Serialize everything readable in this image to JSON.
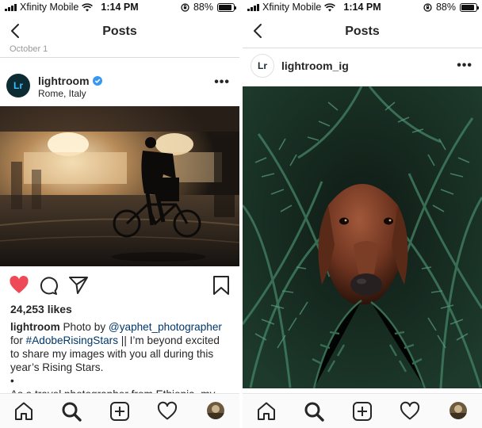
{
  "status_bar": {
    "carrier": "Xfinity Mobile",
    "time": "1:14 PM",
    "battery": "88%",
    "battery_level": 0.88
  },
  "colors": {
    "like_red": "#ed4956",
    "link_blue": "#00376b",
    "verified_blue": "#3897f0",
    "divider": "#dbdbdb"
  },
  "left_screen": {
    "nav_title": "Posts",
    "date_fragment": "October 1",
    "post": {
      "username": "lightroom",
      "verified": true,
      "location": "Rome, Italy",
      "more_icon": "more-dots-icon",
      "liked": true,
      "likes": "24,253 likes",
      "caption": {
        "username": "lightroom",
        "text1": " Photo by ",
        "mention": "@yaphet_photographer",
        "text2": " for ",
        "hashtag": "#AdobeRisingStars",
        "text3": " || I’m beyond excited to share my images with you all during this year’s Rising Stars.",
        "bullet": "•",
        "text4": "As a travel photographer from Ethiopia, my"
      }
    }
  },
  "right_screen": {
    "nav_title": "Posts",
    "post": {
      "username": "lightroom_ig",
      "more_icon": "more-dots-icon"
    }
  },
  "tab_bar": {
    "icons": [
      "home-icon",
      "search-icon",
      "new-post-icon",
      "activity-heart-icon",
      "profile-avatar"
    ]
  }
}
